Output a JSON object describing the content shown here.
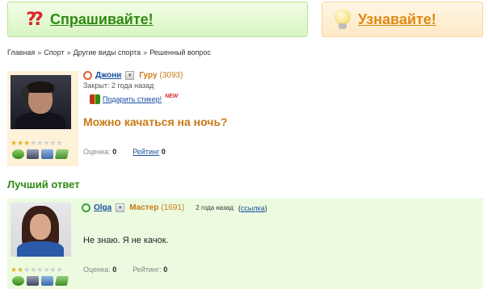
{
  "header": {
    "ask_label": "Спрашивайте!",
    "learn_label": "Узнавайте!",
    "ask_icon": "question-marks-icon",
    "learn_icon": "lightbulb-icon"
  },
  "breadcrumb": [
    "Главная",
    "Спорт",
    "Другие виды спорта",
    "Решенный вопрос"
  ],
  "question": {
    "author": "Джони",
    "rank": "Гуру",
    "score": "(3093)",
    "closed": "Закрыт: 2 года назад",
    "gift_link": "Подарить стикер!",
    "new_badge": "NEW",
    "title": "Можно качаться на ночь?",
    "rating_label": "Оценка:",
    "rating_value": "0",
    "rank_link": "Рейтинг",
    "rank_value": "0",
    "stars_filled": 3,
    "stars_total": 8
  },
  "best_answer": {
    "section_title": "Лучший ответ",
    "author": "Olga",
    "rank": "Мастер",
    "score": "(1691)",
    "time": "2 года назад",
    "ref_link": "ссылка",
    "text": "Не знаю. Я не качок.",
    "rating_label": "Оценка:",
    "rating_value": "0",
    "rank_label": "Рейтинг:",
    "rank_value": "0",
    "stars_filled": 2,
    "stars_total": 8
  },
  "colors": {
    "accent_green": "#2f8a14",
    "accent_orange": "#c87a16",
    "link_blue": "#1a4fa0"
  }
}
